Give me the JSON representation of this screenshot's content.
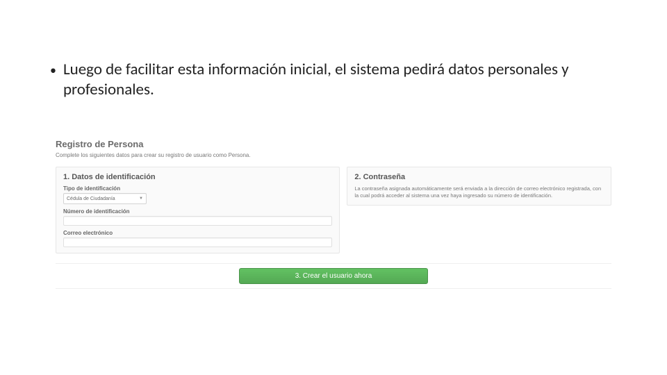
{
  "slide": {
    "bullet_text": "Luego de facilitar esta información inicial, el sistema pedirá datos personales y profesionales."
  },
  "form": {
    "page_title": "Registro de Persona",
    "page_sub": "Complete los siguientes datos para crear su registro de usuario como Persona.",
    "section1_title": "1. Datos de identificación",
    "id_type_label": "Tipo de identificación",
    "id_type_value": "Cédula de Ciudadanía",
    "id_number_label": "Número de identificación",
    "email_label": "Correo electrónico",
    "section2_title": "2. Contraseña",
    "password_text": "La contraseña asignada automáticamente será enviada a la dirección de correo electrónico registrada, con la cual podrá acceder al sistema una vez haya ingresado su número de identificación.",
    "create_button": "3. Crear el usuario ahora"
  }
}
